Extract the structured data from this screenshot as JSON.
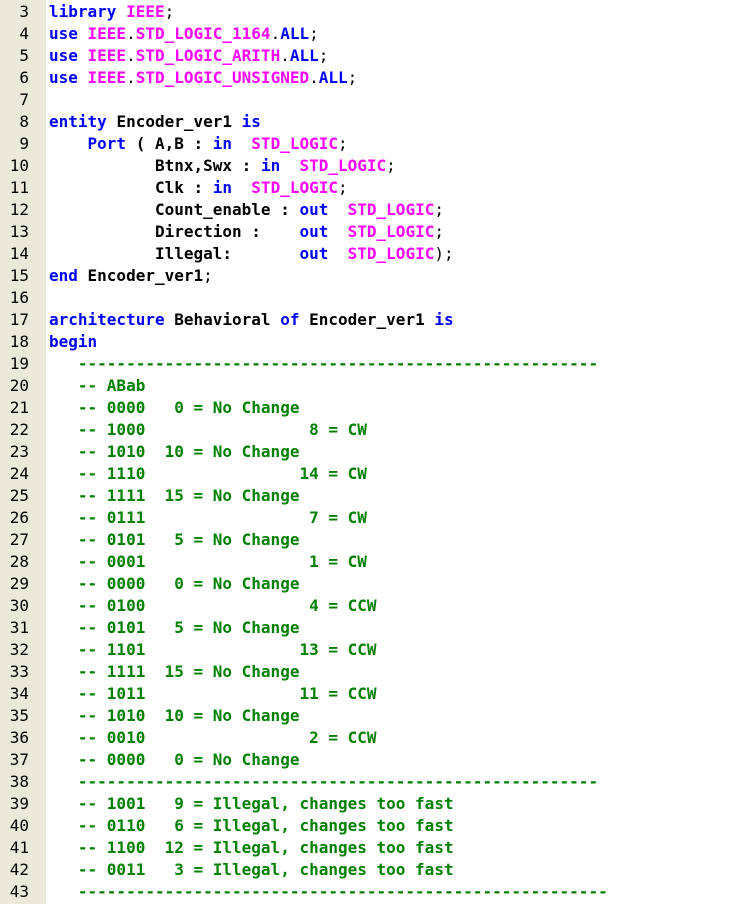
{
  "editor": {
    "language": "VHDL",
    "colors": {
      "keyword": "#0000ff",
      "library": "#ff00ff",
      "comment": "#008000",
      "identifier": "#000000",
      "gutter": "#ebe9d9",
      "background": "#ffffff"
    },
    "lines": [
      {
        "n": "3",
        "tokens": [
          [
            "kw",
            "library "
          ],
          [
            "lib",
            "IEEE"
          ],
          [
            "p",
            ";"
          ]
        ]
      },
      {
        "n": "4",
        "tokens": [
          [
            "kw",
            "use "
          ],
          [
            "lib",
            "IEEE"
          ],
          [
            "p",
            "."
          ],
          [
            "lib",
            "STD_LOGIC_1164"
          ],
          [
            "p",
            "."
          ],
          [
            "kw",
            "ALL"
          ],
          [
            "p",
            ";"
          ]
        ]
      },
      {
        "n": "5",
        "tokens": [
          [
            "kw",
            "use "
          ],
          [
            "lib",
            "IEEE"
          ],
          [
            "p",
            "."
          ],
          [
            "lib",
            "STD_LOGIC_ARITH"
          ],
          [
            "p",
            "."
          ],
          [
            "kw",
            "ALL"
          ],
          [
            "p",
            ";"
          ]
        ]
      },
      {
        "n": "6",
        "tokens": [
          [
            "kw",
            "use "
          ],
          [
            "lib",
            "IEEE"
          ],
          [
            "p",
            "."
          ],
          [
            "lib",
            "STD_LOGIC_UNSIGNED"
          ],
          [
            "p",
            "."
          ],
          [
            "kw",
            "ALL"
          ],
          [
            "p",
            ";"
          ]
        ]
      },
      {
        "n": "7",
        "tokens": []
      },
      {
        "n": "8",
        "tokens": [
          [
            "kw",
            "entity "
          ],
          [
            "id",
            "Encoder_ver1 "
          ],
          [
            "kw",
            "is"
          ]
        ]
      },
      {
        "n": "9",
        "tokens": [
          [
            "p",
            "    "
          ],
          [
            "kw",
            "Port"
          ],
          [
            "id",
            " ( A,B : "
          ],
          [
            "kw",
            "in"
          ],
          [
            "p",
            "  "
          ],
          [
            "lib",
            "STD_LOGIC"
          ],
          [
            "p",
            ";"
          ]
        ]
      },
      {
        "n": "10",
        "tokens": [
          [
            "p",
            "           "
          ],
          [
            "id",
            "Btnx,Swx : "
          ],
          [
            "kw",
            "in"
          ],
          [
            "p",
            "  "
          ],
          [
            "lib",
            "STD_LOGIC"
          ],
          [
            "p",
            ";"
          ]
        ]
      },
      {
        "n": "11",
        "tokens": [
          [
            "p",
            "           "
          ],
          [
            "id",
            "Clk : "
          ],
          [
            "kw",
            "in"
          ],
          [
            "p",
            "  "
          ],
          [
            "lib",
            "STD_LOGIC"
          ],
          [
            "p",
            ";"
          ]
        ]
      },
      {
        "n": "12",
        "tokens": [
          [
            "p",
            "           "
          ],
          [
            "id",
            "Count_enable : "
          ],
          [
            "kw",
            "out"
          ],
          [
            "p",
            "  "
          ],
          [
            "lib",
            "STD_LOGIC"
          ],
          [
            "p",
            ";"
          ]
        ]
      },
      {
        "n": "13",
        "tokens": [
          [
            "p",
            "           "
          ],
          [
            "id",
            "Direction :    "
          ],
          [
            "kw",
            "out"
          ],
          [
            "p",
            "  "
          ],
          [
            "lib",
            "STD_LOGIC"
          ],
          [
            "p",
            ";"
          ]
        ]
      },
      {
        "n": "14",
        "tokens": [
          [
            "p",
            "           "
          ],
          [
            "id",
            "Illegal:       "
          ],
          [
            "kw",
            "out"
          ],
          [
            "p",
            "  "
          ],
          [
            "lib",
            "STD_LOGIC"
          ],
          [
            "p",
            ");"
          ]
        ]
      },
      {
        "n": "15",
        "tokens": [
          [
            "kw",
            "end "
          ],
          [
            "id",
            "Encoder_ver1"
          ],
          [
            "p",
            ";"
          ]
        ]
      },
      {
        "n": "16",
        "tokens": []
      },
      {
        "n": "17",
        "tokens": [
          [
            "kw",
            "architecture "
          ],
          [
            "id",
            "Behavioral "
          ],
          [
            "kw",
            "of "
          ],
          [
            "id",
            "Encoder_ver1 "
          ],
          [
            "kw",
            "is"
          ]
        ]
      },
      {
        "n": "18",
        "tokens": [
          [
            "kw",
            "begin"
          ]
        ]
      },
      {
        "n": "19",
        "tokens": [
          [
            "com",
            "   ------------------------------------------------------"
          ]
        ]
      },
      {
        "n": "20",
        "tokens": [
          [
            "com",
            "   -- ABab"
          ]
        ]
      },
      {
        "n": "21",
        "tokens": [
          [
            "com",
            "   -- 0000   0 = No Change"
          ]
        ]
      },
      {
        "n": "22",
        "tokens": [
          [
            "com",
            "   -- 1000                 8 = CW"
          ]
        ]
      },
      {
        "n": "23",
        "tokens": [
          [
            "com",
            "   -- 1010  10 = No Change"
          ]
        ]
      },
      {
        "n": "24",
        "tokens": [
          [
            "com",
            "   -- 1110                14 = CW"
          ]
        ]
      },
      {
        "n": "25",
        "tokens": [
          [
            "com",
            "   -- 1111  15 = No Change"
          ]
        ]
      },
      {
        "n": "26",
        "tokens": [
          [
            "com",
            "   -- 0111                 7 = CW"
          ]
        ]
      },
      {
        "n": "27",
        "tokens": [
          [
            "com",
            "   -- 0101   5 = No Change"
          ]
        ]
      },
      {
        "n": "28",
        "tokens": [
          [
            "com",
            "   -- 0001                 1 = CW"
          ]
        ]
      },
      {
        "n": "29",
        "tokens": [
          [
            "com",
            "   -- 0000   0 = No Change"
          ]
        ]
      },
      {
        "n": "30",
        "tokens": [
          [
            "com",
            "   -- 0100                 4 = CCW"
          ]
        ]
      },
      {
        "n": "31",
        "tokens": [
          [
            "com",
            "   -- 0101   5 = No Change"
          ]
        ]
      },
      {
        "n": "32",
        "tokens": [
          [
            "com",
            "   -- 1101                13 = CCW"
          ]
        ]
      },
      {
        "n": "33",
        "tokens": [
          [
            "com",
            "   -- 1111  15 = No Change"
          ]
        ]
      },
      {
        "n": "34",
        "tokens": [
          [
            "com",
            "   -- 1011                11 = CCW"
          ]
        ]
      },
      {
        "n": "35",
        "tokens": [
          [
            "com",
            "   -- 1010  10 = No Change"
          ]
        ]
      },
      {
        "n": "36",
        "tokens": [
          [
            "com",
            "   -- 0010                 2 = CCW"
          ]
        ]
      },
      {
        "n": "37",
        "tokens": [
          [
            "com",
            "   -- 0000   0 = No Change"
          ]
        ]
      },
      {
        "n": "38",
        "tokens": [
          [
            "com",
            "   ------------------------------------------------------"
          ]
        ]
      },
      {
        "n": "39",
        "tokens": [
          [
            "com",
            "   -- 1001   9 = Illegal, changes too fast"
          ]
        ]
      },
      {
        "n": "40",
        "tokens": [
          [
            "com",
            "   -- 0110   6 = Illegal, changes too fast"
          ]
        ]
      },
      {
        "n": "41",
        "tokens": [
          [
            "com",
            "   -- 1100  12 = Illegal, changes too fast"
          ]
        ]
      },
      {
        "n": "42",
        "tokens": [
          [
            "com",
            "   -- 0011   3 = Illegal, changes too fast"
          ]
        ]
      },
      {
        "n": "43",
        "tokens": [
          [
            "com",
            "   -------------------------------------------------------"
          ]
        ]
      }
    ]
  }
}
